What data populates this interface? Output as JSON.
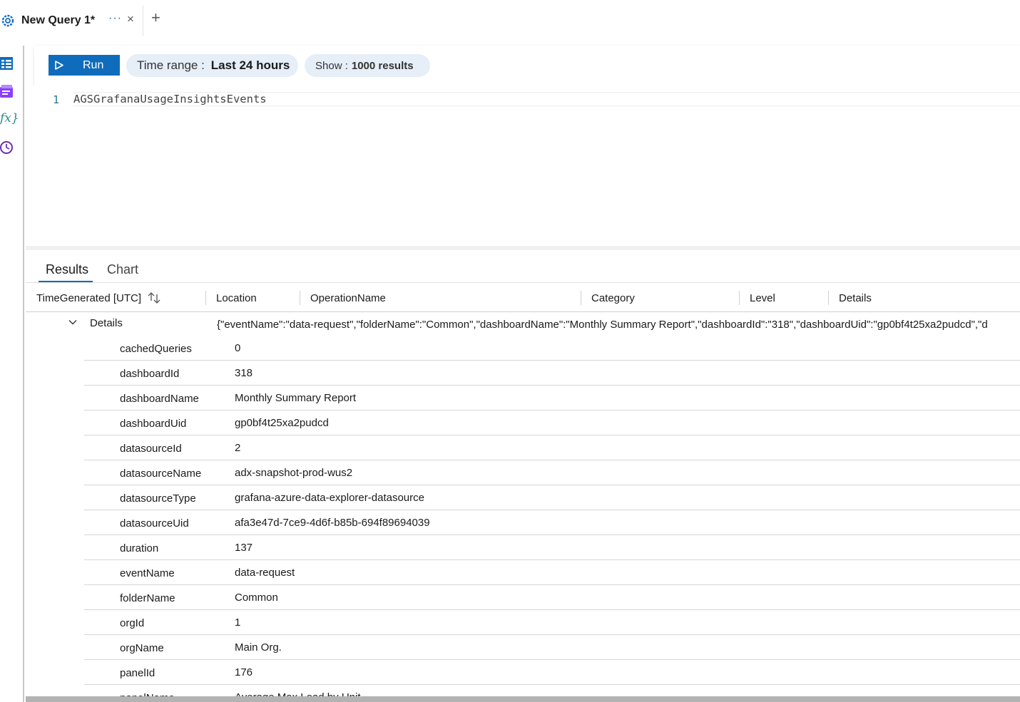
{
  "tab": {
    "title": "New Query 1*",
    "more": "···",
    "close": "×",
    "add": "+"
  },
  "rail": {
    "icons": [
      "tables-icon",
      "queries-icon",
      "functions-icon",
      "history-icon"
    ],
    "functions_glyph": "fx}"
  },
  "toolbar": {
    "run_label": "Run",
    "time_range_label": "Time range :",
    "time_range_value": "Last 24 hours",
    "show_label": "Show :",
    "show_value": "1000 results"
  },
  "editor": {
    "line_number": "1",
    "query": "AGSGrafanaUsageInsightsEvents"
  },
  "result_tabs": {
    "results": "Results",
    "chart": "Chart",
    "active": "Results"
  },
  "grid": {
    "columns": [
      "TimeGenerated [UTC]",
      "Location",
      "OperationName",
      "Category",
      "Level",
      "Details"
    ],
    "details_label": "Details",
    "details_json": "{\"eventName\":\"data-request\",\"folderName\":\"Common\",\"dashboardName\":\"Monthly Summary Report\",\"dashboardId\":\"318\",\"dashboardUid\":\"gp0bf4t25xa2pudcd\",\"d",
    "rows": [
      {
        "key": "cachedQueries",
        "value": "0"
      },
      {
        "key": "dashboardId",
        "value": "318"
      },
      {
        "key": "dashboardName",
        "value": "Monthly Summary Report"
      },
      {
        "key": "dashboardUid",
        "value": "gp0bf4t25xa2pudcd"
      },
      {
        "key": "datasourceId",
        "value": "2"
      },
      {
        "key": "datasourceName",
        "value": "adx-snapshot-prod-wus2"
      },
      {
        "key": "datasourceType",
        "value": "grafana-azure-data-explorer-datasource"
      },
      {
        "key": "datasourceUid",
        "value": "afa3e47d-7ce9-4d6f-b85b-694f89694039"
      },
      {
        "key": "duration",
        "value": "137"
      },
      {
        "key": "eventName",
        "value": "data-request"
      },
      {
        "key": "folderName",
        "value": "Common"
      },
      {
        "key": "orgId",
        "value": "1"
      },
      {
        "key": "orgName",
        "value": "Main Org."
      },
      {
        "key": "panelId",
        "value": "176"
      },
      {
        "key": "panelName",
        "value": "Average Max Load by Unit"
      }
    ]
  },
  "colors": {
    "accent": "#0f6cbd",
    "pill_bg": "#e6eef8",
    "line_number": "#237893"
  }
}
